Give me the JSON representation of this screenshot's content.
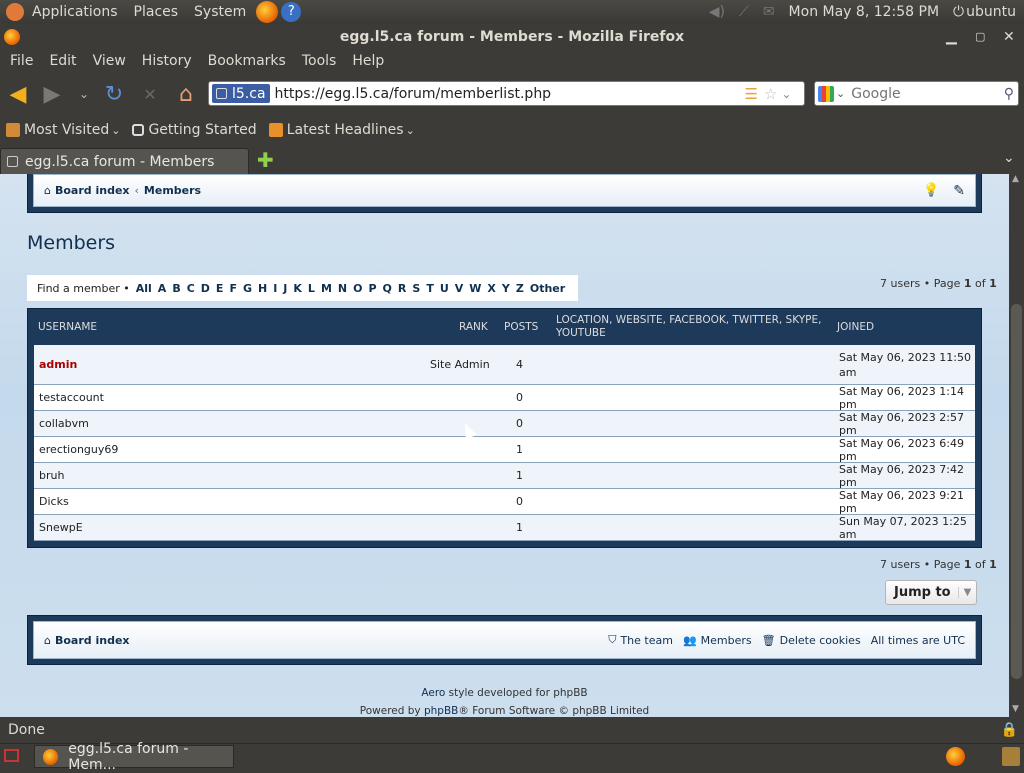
{
  "gnome": {
    "menus": [
      "Applications",
      "Places",
      "System"
    ],
    "datetime": "Mon May  8, 12:58 PM",
    "user": "ubuntu"
  },
  "window": {
    "title": "egg.l5.ca forum - Members - Mozilla Firefox"
  },
  "menubar": [
    "File",
    "Edit",
    "View",
    "History",
    "Bookmarks",
    "Tools",
    "Help"
  ],
  "nav": {
    "site_id": "l5.ca",
    "url": "https://egg.l5.ca/forum/memberlist.php",
    "search_engine": "Google"
  },
  "bookmarks": [
    "Most Visited",
    "Getting Started",
    "Latest Headlines"
  ],
  "tab": {
    "label": "egg.l5.ca forum - Members"
  },
  "forum": {
    "breadcrumb_home": "Board index",
    "breadcrumb_sep": "‹",
    "breadcrumb_current": "Members",
    "page_title": "Members",
    "find_member_label": "Find a member •",
    "letters": [
      "All",
      "A",
      "B",
      "C",
      "D",
      "E",
      "F",
      "G",
      "H",
      "I",
      "J",
      "K",
      "L",
      "M",
      "N",
      "O",
      "P",
      "Q",
      "R",
      "S",
      "T",
      "U",
      "V",
      "W",
      "X",
      "Y",
      "Z",
      "Other"
    ],
    "pagination_prefix": "7 users • Page ",
    "pagination_page": "1",
    "pagination_of": " of ",
    "pagination_total": "1",
    "columns": {
      "username": "Username",
      "rank": "Rank",
      "posts": "Posts",
      "location_1": "Location, Website, Facebook, Twitter, Skype,",
      "location_2": "YouTube",
      "joined": "Joined"
    },
    "members": [
      {
        "username": "admin",
        "rank": "Site Admin",
        "posts": "4",
        "joined": "Sat May 06, 2023 11:50",
        "joined2": "am"
      },
      {
        "username": "testaccount",
        "rank": "",
        "posts": "0",
        "joined": "Sat May 06, 2023 1:14 pm",
        "joined2": ""
      },
      {
        "username": "collabvm",
        "rank": "",
        "posts": "0",
        "joined": "Sat May 06, 2023 2:57 pm",
        "joined2": ""
      },
      {
        "username": "erectionguy69",
        "rank": "",
        "posts": "1",
        "joined": "Sat May 06, 2023 6:49 pm",
        "joined2": ""
      },
      {
        "username": "bruh",
        "rank": "",
        "posts": "1",
        "joined": "Sat May 06, 2023 7:42 pm",
        "joined2": ""
      },
      {
        "username": "Dicks",
        "rank": "",
        "posts": "0",
        "joined": "Sat May 06, 2023 9:21 pm",
        "joined2": ""
      },
      {
        "username": "SnewpE",
        "rank": "",
        "posts": "1",
        "joined": "Sun May 07, 2023 1:25 am",
        "joined2": ""
      }
    ],
    "jump_to": "Jump to",
    "footer_links": {
      "team": "The team",
      "members": "Members",
      "delete_cookies": "Delete cookies",
      "timezone": "All times are UTC"
    },
    "style_credit_1": "Aero",
    "style_credit_2": " style developed for phpBB",
    "powered_1": "Powered by ",
    "powered_2": "phpBB",
    "powered_3": "® Forum Software © phpBB Limited"
  },
  "status": "Done",
  "taskbar": {
    "item": "egg.l5.ca forum - Mem..."
  },
  "colors": {
    "admin": "#aa0000",
    "link": "#103050",
    "chrome": "#3c3b37"
  }
}
